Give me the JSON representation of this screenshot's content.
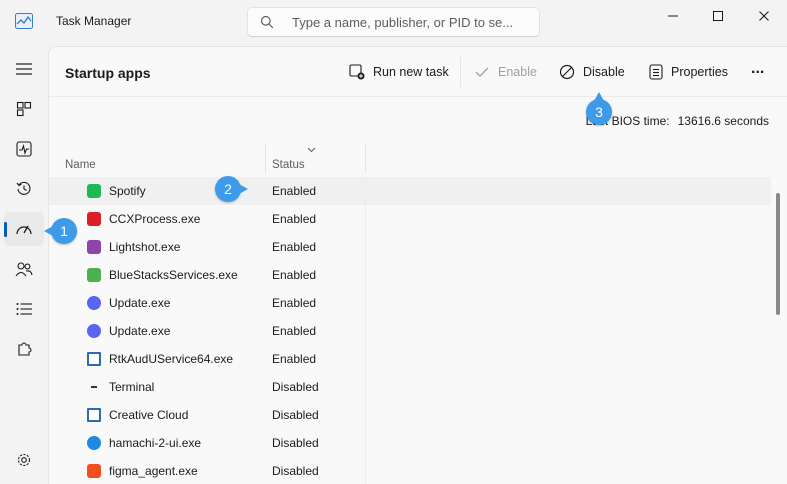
{
  "app": {
    "title": "Task Manager"
  },
  "search": {
    "placeholder": "Type a name, publisher, or PID to se..."
  },
  "nav": {
    "items": [
      "hamburger-menu",
      "processes",
      "performance",
      "app-history",
      "startup-apps",
      "users",
      "details",
      "services",
      "settings"
    ],
    "active": "startup-apps"
  },
  "page": {
    "title": "Startup apps"
  },
  "toolbar": {
    "run_new_task": "Run new task",
    "enable": "Enable",
    "disable": "Disable",
    "properties": "Properties",
    "more": "..."
  },
  "bios": {
    "label": "Last BIOS time:",
    "value": "13616.6 seconds"
  },
  "table": {
    "columns": [
      "Name",
      "Status"
    ],
    "rows": [
      {
        "name": "Spotify",
        "status": "Enabled",
        "icon": "spotify-icon",
        "color": "#1db954"
      },
      {
        "name": "CCXProcess.exe",
        "status": "Enabled",
        "icon": "creative-cloud-icon",
        "color": "#da1f26"
      },
      {
        "name": "Lightshot.exe",
        "status": "Enabled",
        "icon": "lightshot-feather-icon",
        "color": "#8e44ad"
      },
      {
        "name": "BlueStacksServices.exe",
        "status": "Enabled",
        "icon": "bluestacks-icon",
        "color": "#4caf50"
      },
      {
        "name": "Update.exe",
        "status": "Enabled",
        "icon": "discord-icon",
        "color": "#5865f2"
      },
      {
        "name": "Update.exe",
        "status": "Enabled",
        "icon": "discord-icon",
        "color": "#5865f2"
      },
      {
        "name": "RtkAudUService64.exe",
        "status": "Enabled",
        "icon": "window-app-icon",
        "color": "#2b6cb0"
      },
      {
        "name": "Terminal",
        "status": "Disabled",
        "icon": "terminal-icon",
        "color": "#333333"
      },
      {
        "name": "Creative Cloud",
        "status": "Disabled",
        "icon": "window-app-icon",
        "color": "#2b6cb0"
      },
      {
        "name": "hamachi-2-ui.exe",
        "status": "Disabled",
        "icon": "hamachi-icon",
        "color": "#1e88e5"
      },
      {
        "name": "figma_agent.exe",
        "status": "Disabled",
        "icon": "figma-icon",
        "color": "#f24e1e"
      }
    ]
  },
  "callouts": [
    "1",
    "2",
    "3"
  ],
  "colors": {
    "accent": "#005fb8",
    "callout": "#3d9be9",
    "row_highlight": "#f0f0f0"
  }
}
